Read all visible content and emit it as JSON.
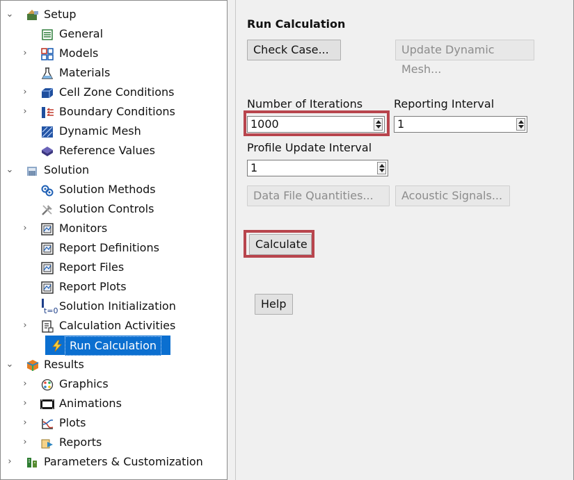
{
  "tree": {
    "items": [
      {
        "label": "Setup",
        "arrow": "expanded",
        "icon": "setup-icon"
      },
      {
        "label": "General",
        "arrow": "none",
        "icon": "general-icon"
      },
      {
        "label": "Models",
        "arrow": "collapsed",
        "icon": "models-icon"
      },
      {
        "label": "Materials",
        "arrow": "none",
        "icon": "materials-icon"
      },
      {
        "label": "Cell Zone Conditions",
        "arrow": "collapsed",
        "icon": "cell-zone-icon"
      },
      {
        "label": "Boundary Conditions",
        "arrow": "collapsed",
        "icon": "boundary-icon"
      },
      {
        "label": "Dynamic Mesh",
        "arrow": "none",
        "icon": "dynamic-mesh-icon"
      },
      {
        "label": "Reference Values",
        "arrow": "none",
        "icon": "reference-values-icon"
      },
      {
        "label": "Solution",
        "arrow": "expanded",
        "icon": "solution-icon"
      },
      {
        "label": "Solution Methods",
        "arrow": "none",
        "icon": "solution-methods-icon"
      },
      {
        "label": "Solution Controls",
        "arrow": "none",
        "icon": "solution-controls-icon"
      },
      {
        "label": "Monitors",
        "arrow": "collapsed",
        "icon": "monitors-icon"
      },
      {
        "label": "Report Definitions",
        "arrow": "none",
        "icon": "report-definitions-icon"
      },
      {
        "label": "Report Files",
        "arrow": "none",
        "icon": "report-files-icon"
      },
      {
        "label": "Report Plots",
        "arrow": "none",
        "icon": "report-plots-icon"
      },
      {
        "label": "Solution Initialization",
        "arrow": "none",
        "icon": "initialization-icon"
      },
      {
        "label": "Calculation Activities",
        "arrow": "collapsed",
        "icon": "calculation-activities-icon"
      },
      {
        "label": "Run Calculation",
        "arrow": "none",
        "icon": "run-calculation-icon",
        "selected": true
      },
      {
        "label": "Results",
        "arrow": "expanded",
        "icon": "results-icon"
      },
      {
        "label": "Graphics",
        "arrow": "collapsed",
        "icon": "graphics-icon"
      },
      {
        "label": "Animations",
        "arrow": "collapsed",
        "icon": "animations-icon"
      },
      {
        "label": "Plots",
        "arrow": "collapsed",
        "icon": "plots-icon"
      },
      {
        "label": "Reports",
        "arrow": "collapsed",
        "icon": "reports-icon"
      },
      {
        "label": "Parameters & Customization",
        "arrow": "collapsed",
        "icon": "parameters-icon"
      }
    ]
  },
  "panel": {
    "title": "Run Calculation",
    "check_case_label": "Check Case...",
    "update_mesh_label": "Update Dynamic Mesh...",
    "iterations_label": "Number of Iterations",
    "iterations_value": "1000",
    "reporting_label": "Reporting Interval",
    "reporting_value": "1",
    "profile_label": "Profile Update Interval",
    "profile_value": "1",
    "data_file_label": "Data File Quantities...",
    "acoustic_label": "Acoustic Signals...",
    "calculate_label": "Calculate",
    "help_label": "Help"
  },
  "colors": {
    "highlight": "#b8454d",
    "selection": "#0b6fd0"
  }
}
